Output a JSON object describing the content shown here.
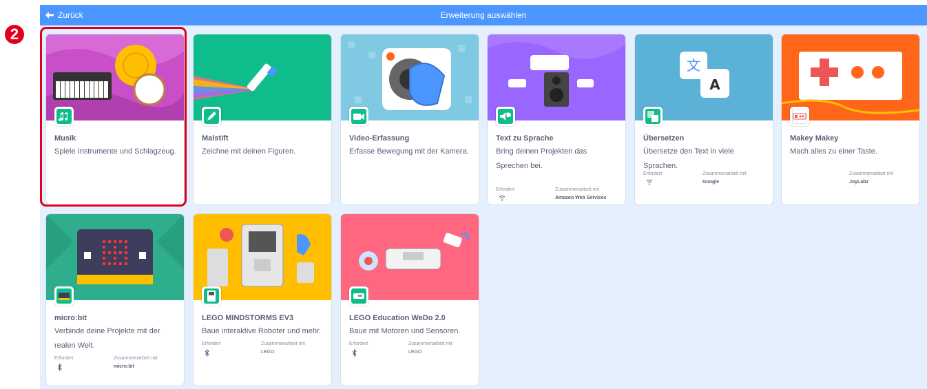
{
  "header": {
    "back_label": "Zurück",
    "title": "Erweiterung auswählen"
  },
  "step_marker": "2",
  "labels": {
    "required": "Erfordert",
    "collaboration": "Zusammenarbeit mit"
  },
  "cards": [
    {
      "name": "Musik",
      "desc": "Spiele Instrumente und Schlagzeug.",
      "banner_color": "#c94fc9",
      "selected": true
    },
    {
      "name": "Malstift",
      "desc": "Zeichne mit deinen Figuren.",
      "banner_color": "#0fbd8c"
    },
    {
      "name": "Video-Erfassung",
      "desc": "Erfasse Bewegung mit der Kamera.",
      "banner_color": "#7fc9e3"
    },
    {
      "name": "Text zu Sprache",
      "desc": "Bring deinen Projekten das Sprechen bei.",
      "banner_color": "#9966ff",
      "partner": "Amazon Web Services",
      "requires": "wifi-icon"
    },
    {
      "name": "Übersetzen",
      "desc": "Übersetze den Text in viele Sprachen.",
      "banner_color": "#5cb1d6",
      "partner": "Google",
      "requires": "wifi-icon"
    },
    {
      "name": "Makey Makey",
      "desc": "Mach alles zu einer Taste.",
      "banner_color": "#ff661a",
      "partner": "JoyLabz"
    },
    {
      "name": "micro:bit",
      "desc": "Verbinde deine Projekte mit der realen Welt.",
      "banner_color": "#2fae8e",
      "partner": "micro:bit",
      "requires": "bluetooth-icon"
    },
    {
      "name": "LEGO MINDSTORMS EV3",
      "desc": "Baue interaktive Roboter und mehr.",
      "banner_color": "#ffbf00",
      "partner": "LEGO",
      "requires": "bluetooth-icon"
    },
    {
      "name": "LEGO Education WeDo 2.0",
      "desc": "Baue mit Motoren und Sensoren.",
      "banner_color": "#ff6680",
      "partner": "LEGO",
      "requires": "bluetooth-icon"
    }
  ],
  "colors": {
    "header_bg": "#4c97ff",
    "canvas_bg": "#e5f0ff",
    "highlight": "#e0001a",
    "text": "#575e75"
  }
}
